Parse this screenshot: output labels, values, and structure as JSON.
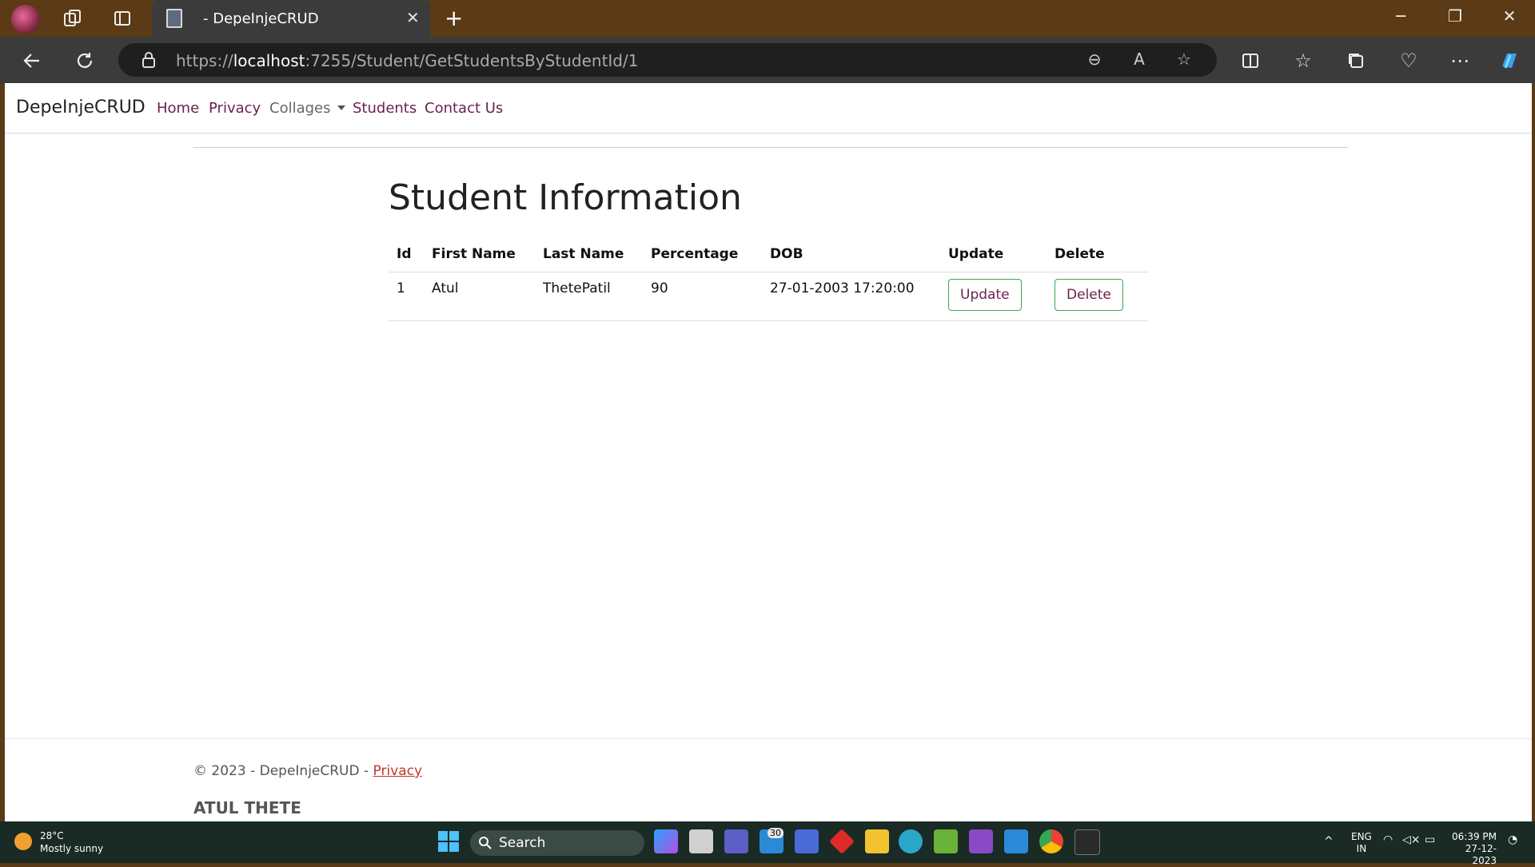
{
  "browser": {
    "tab_title": "- DepeInjeCRUD",
    "url_scheme": "https://",
    "url_host": "localhost",
    "url_rest": ":7255/Student/GetStudentsByStudentId/1"
  },
  "navbar": {
    "brand": "DepeInjeCRUD",
    "links": [
      "Home",
      "Privacy",
      "Collages",
      "Students",
      "Contact Us"
    ]
  },
  "page": {
    "title": "Student Information",
    "columns": [
      "Id",
      "First Name",
      "Last Name",
      "Percentage",
      "DOB",
      "Update",
      "Delete"
    ],
    "rows": [
      {
        "id": "1",
        "first_name": "Atul",
        "last_name": "ThetePatil",
        "percentage": "90",
        "dob": "27-01-2003 17:20:00",
        "update_label": "Update",
        "delete_label": "Delete"
      }
    ]
  },
  "footer": {
    "copyright": "© 2023 - DepeInjeCRUD - ",
    "privacy_link": "Privacy",
    "author": "ATUL THETE"
  },
  "taskbar": {
    "weather_temp": "28°C",
    "weather_desc": "Mostly sunny",
    "search_label": "Search",
    "mail_badge": "30",
    "lang": "ENG",
    "region": "IN",
    "time": "06:39 PM",
    "date": "27-12-2023"
  },
  "colors": {
    "nav_link": "#6b1f4e",
    "button_border": "#3aa657",
    "titlebar": "#5b3a15"
  }
}
